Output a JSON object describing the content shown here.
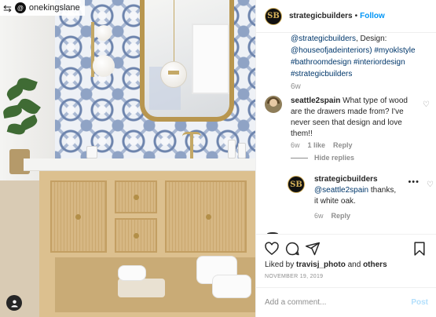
{
  "repost": {
    "icon": "repost-icon",
    "avatar_initial": "@",
    "username": "onekingslane"
  },
  "post": {
    "username": "strategicbuilders",
    "separator": "•",
    "follow_label": "Follow",
    "avatar_initial": "SB"
  },
  "caption": {
    "line1_mention": "@strategicbuilders",
    "line1_text": ", Design:",
    "line2": "@houseofjadeinteriors) #myoklstyle",
    "line3": "#bathroomdesign #interiordesign",
    "line4": "#strategicbuilders",
    "time": "6w"
  },
  "comments": [
    {
      "username": "seattle2spain",
      "text": "What type of wood are the drawers made from? I've never seen that design and love them!!",
      "time": "6w",
      "likes": "1 like",
      "reply_label": "Reply",
      "hide_replies": "Hide replies",
      "replies": [
        {
          "username": "strategicbuilders",
          "mention": "@seattle2spain",
          "text": " thanks, it white oak.",
          "time": "6w",
          "reply_label": "Reply",
          "more": "•••"
        }
      ]
    }
  ],
  "actions": {
    "liked_by_prefix": "Liked by ",
    "liked_by_user": "travisj_photo",
    "liked_by_mid": " and ",
    "liked_by_others": "others",
    "date": "NOVEMBER 19, 2019"
  },
  "add_comment": {
    "placeholder": "Add a comment...",
    "post_label": "Post"
  },
  "colors": {
    "link": "#00376b",
    "follow": "#0095f6",
    "post_disabled": "#b2dffc",
    "muted": "#8e8e8e",
    "brand_gold": "#d6b25b"
  }
}
